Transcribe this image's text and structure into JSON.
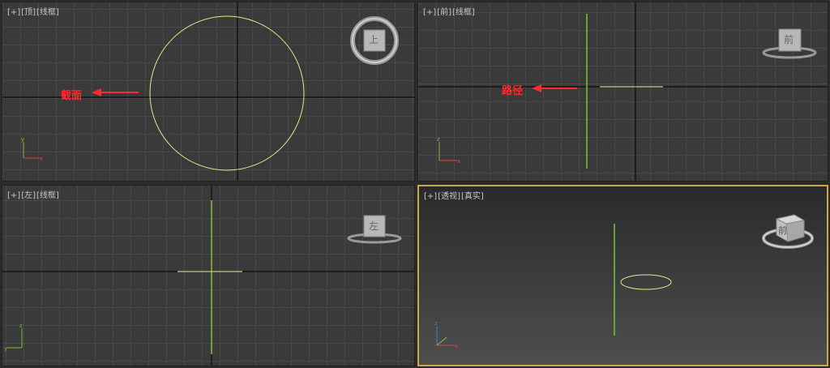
{
  "viewports": {
    "top": {
      "plus": "[+]",
      "view": "[顶]",
      "shade": "[线框]",
      "cube": "上"
    },
    "front": {
      "plus": "[+]",
      "view": "[前]",
      "shade": "[线框]",
      "cube": "前"
    },
    "left": {
      "plus": "[+]",
      "view": "[左]",
      "shade": "[线框]",
      "cube": "左"
    },
    "persp": {
      "plus": "[+]",
      "view": "[透视]",
      "shade": "[真实]",
      "cube": "前"
    }
  },
  "annotations": {
    "section": "截面",
    "path": "路径"
  },
  "colors": {
    "grid": "#5a5a5a",
    "bg": "#3a3a3a",
    "shape": "#e6e68a",
    "path_line": "#7fbf3f",
    "axis": "#000000",
    "arrow": "#ff2a2a",
    "active_border": "#c9a94a"
  }
}
